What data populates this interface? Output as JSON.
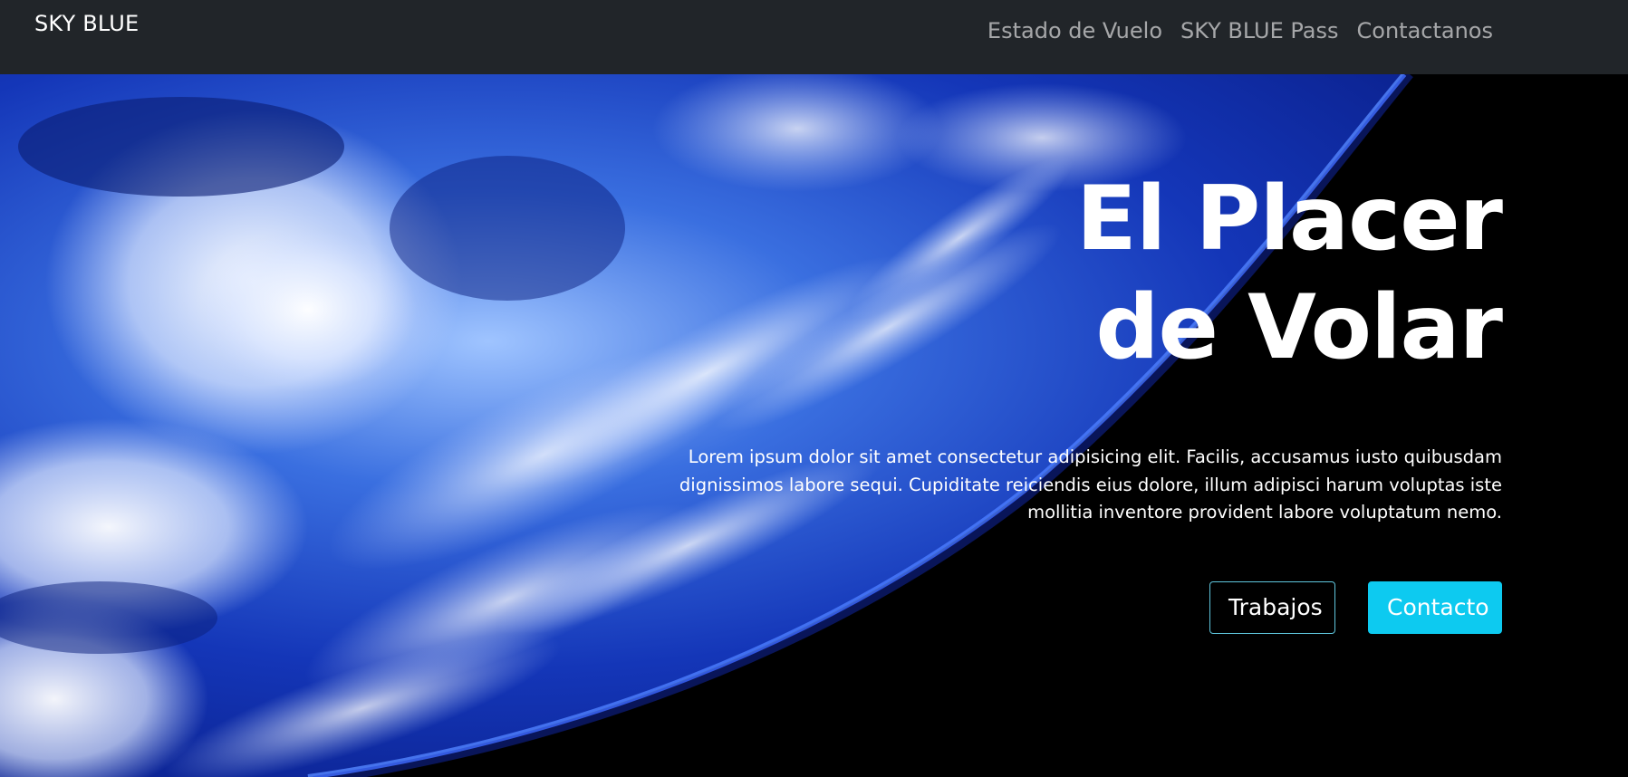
{
  "navbar": {
    "brand": "SKY BLUE",
    "links": [
      {
        "label": "Estado de Vuelo"
      },
      {
        "label": "SKY BLUE Pass"
      },
      {
        "label": "Contactanos"
      }
    ],
    "background": "#212529"
  },
  "hero": {
    "title_line1": "El Placer",
    "title_line2": "de Volar",
    "description": "Lorem ipsum dolor sit amet consectetur adipisicing elit. Facilis, accusamus iusto quibusdam dignissimos labore sequi. Cupiditate reiciendis eius dolore, illum adipisci harum voluptas iste mollitia inventore provident labore voluptatum nemo.",
    "buttons": {
      "secondary_label": "Trabajos",
      "primary_label": "Contacto"
    },
    "image": "earth-from-space",
    "accent_color": "#0dcaf0"
  }
}
